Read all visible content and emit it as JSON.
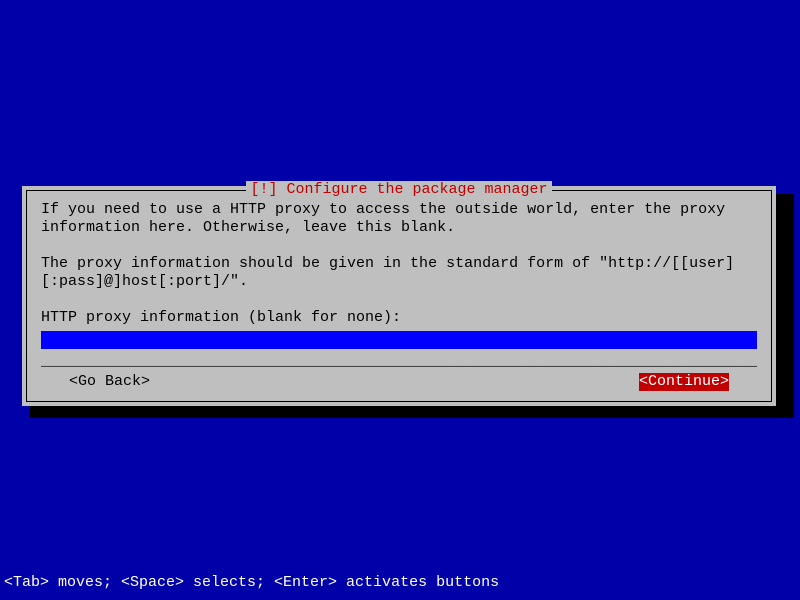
{
  "dialog": {
    "title_prefix": "[!]",
    "title_text": "Configure the package manager",
    "paragraph1": "If you need to use a HTTP proxy to access the outside world, enter the proxy information here. Otherwise, leave this blank.",
    "paragraph2": "The proxy information should be given in the standard form of \"http://[[user][:pass]@]host[:port]/\".",
    "prompt": "HTTP proxy information (blank for none):",
    "input_value": "",
    "goback_label": "<Go Back>",
    "continue_label": "<Continue>"
  },
  "footer": {
    "hint": "<Tab> moves; <Space> selects; <Enter> activates buttons"
  }
}
